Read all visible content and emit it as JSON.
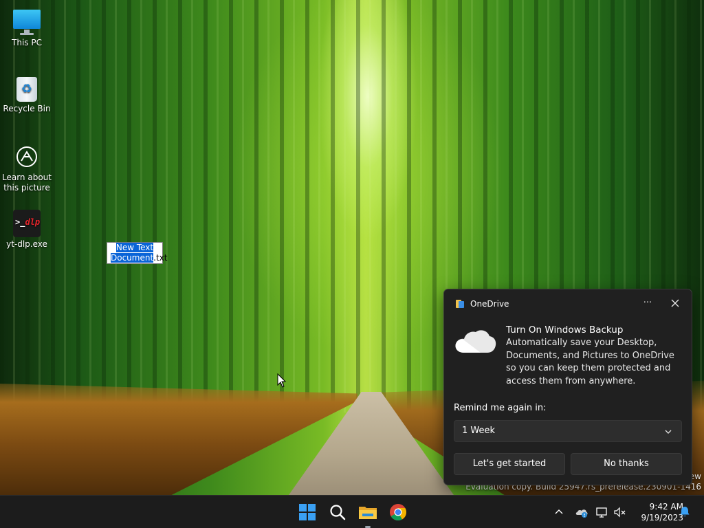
{
  "desktop": {
    "icons": [
      {
        "name": "desktop-icon-this-pc",
        "label": "This PC"
      },
      {
        "name": "desktop-icon-recycle-bin",
        "label": "Recycle Bin"
      },
      {
        "name": "desktop-icon-learn-about",
        "label_line1": "Learn about",
        "label_line2": "this picture"
      },
      {
        "name": "desktop-icon-ytdlp",
        "label": "yt-dlp.exe",
        "logo_prompt": ">_",
        "logo_text": "dlp"
      }
    ],
    "rename": {
      "line1": "New Text",
      "line2_selected": "Document",
      "line2_rest": ".txt"
    },
    "watermark": {
      "line1": "ew",
      "line2": "Evaluation copy. Build 25947.rs_prerelease.230901-1416"
    }
  },
  "toast": {
    "app_name": "OneDrive",
    "more_label": "···",
    "title": "Turn On Windows Backup",
    "body": "Automatically save your Desktop, Documents, and Pictures to OneDrive so you can keep them protected and access them from anywhere.",
    "remind_label": "Remind me again in:",
    "remind_value": "1 Week",
    "primary_button": "Let's get started",
    "secondary_button": "No thanks"
  },
  "taskbar": {
    "apps": [
      "start-icon",
      "search-icon",
      "file-explorer-icon",
      "chrome-icon"
    ],
    "tray": [
      "chevron-up-icon",
      "onedrive-tray-icon",
      "network-icon",
      "volume-muted-icon"
    ],
    "time": "9:42 AM",
    "date": "9/19/2023"
  },
  "colors": {
    "accent": "#0a64d8",
    "taskbar": "#1c1c1c",
    "toast_bg": "#202020"
  }
}
